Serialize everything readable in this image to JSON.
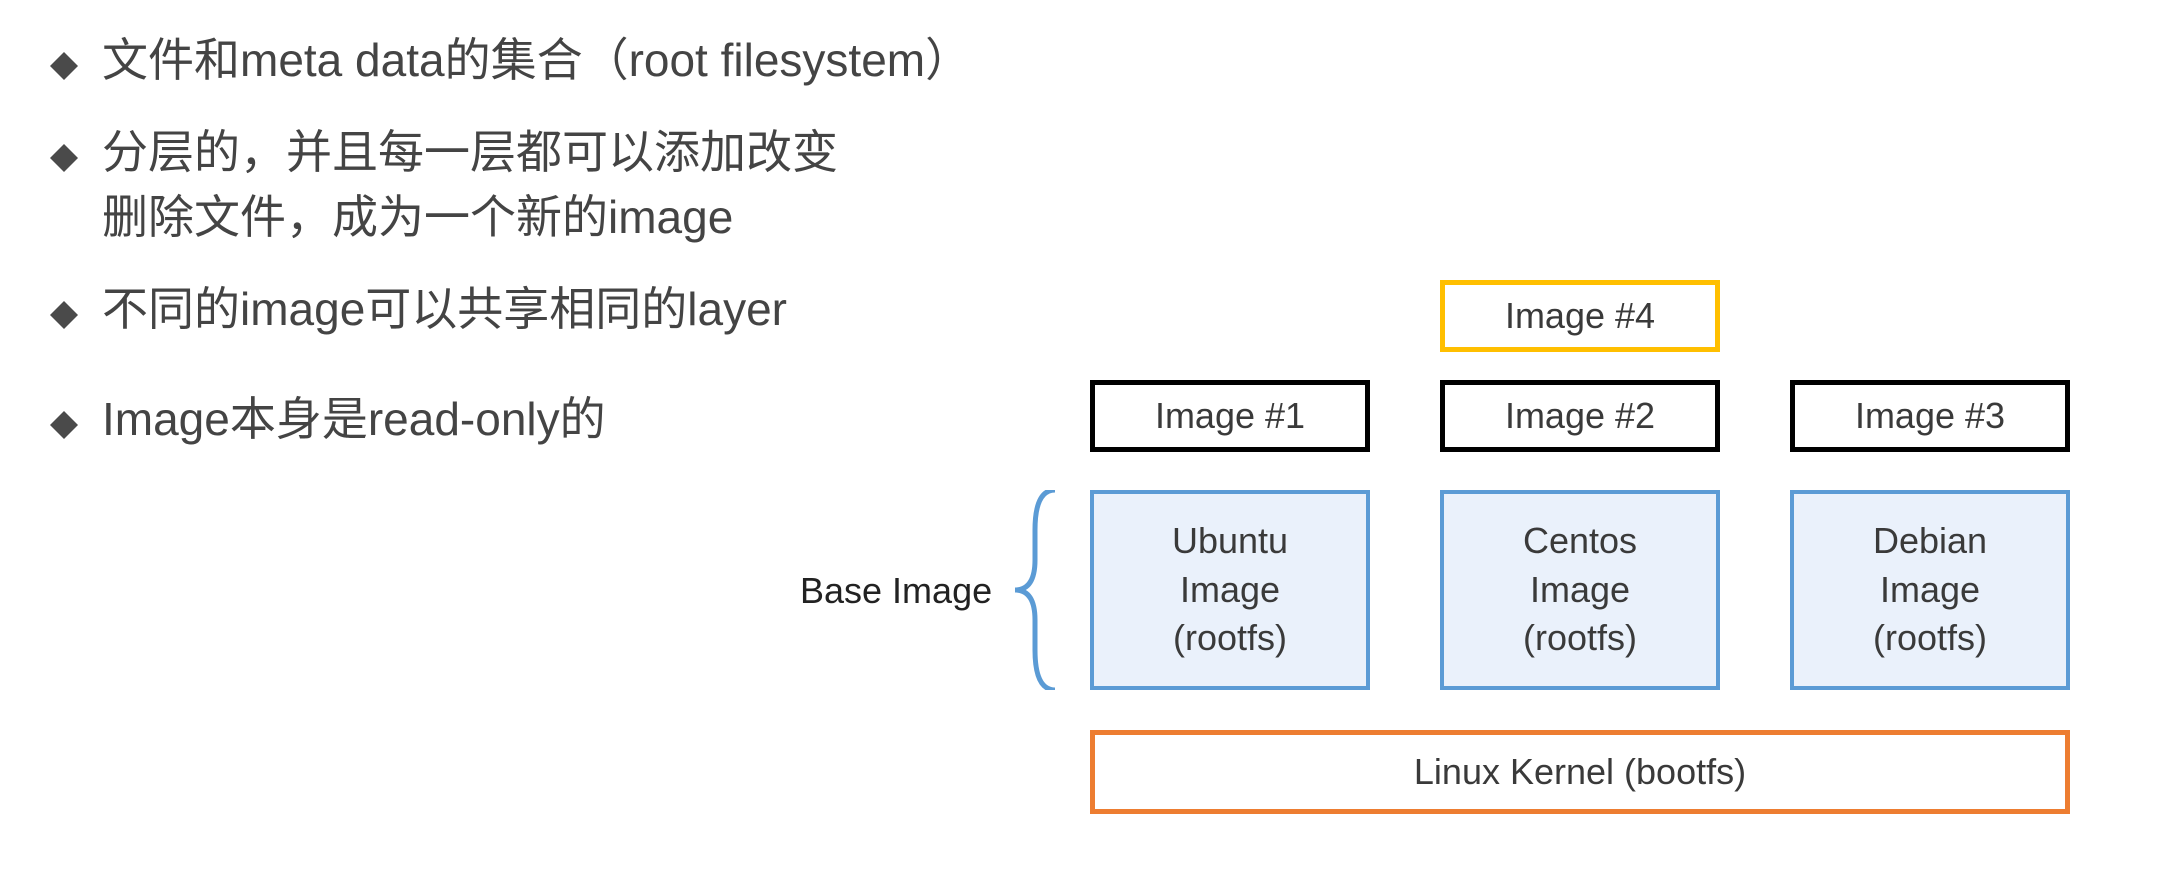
{
  "bullets": {
    "b1": "文件和meta data的集合（root filesystem）",
    "b2": "分层的，并且每一层都可以添加改变\n删除文件，成为一个新的image",
    "b3": "不同的image可以共享相同的layer",
    "b4": "Image本身是read-only的"
  },
  "diagram": {
    "base_label": "Base Image",
    "image4": "Image #4",
    "cols": {
      "c1": {
        "img": "Image #1",
        "base": "Ubuntu\nImage\n(rootfs)"
      },
      "c2": {
        "img": "Image #2",
        "base": "Centos\nImage\n(rootfs)"
      },
      "c3": {
        "img": "Image #3",
        "base": "Debian\nImage\n(rootfs)"
      }
    },
    "kernel": "Linux Kernel (bootfs)"
  }
}
